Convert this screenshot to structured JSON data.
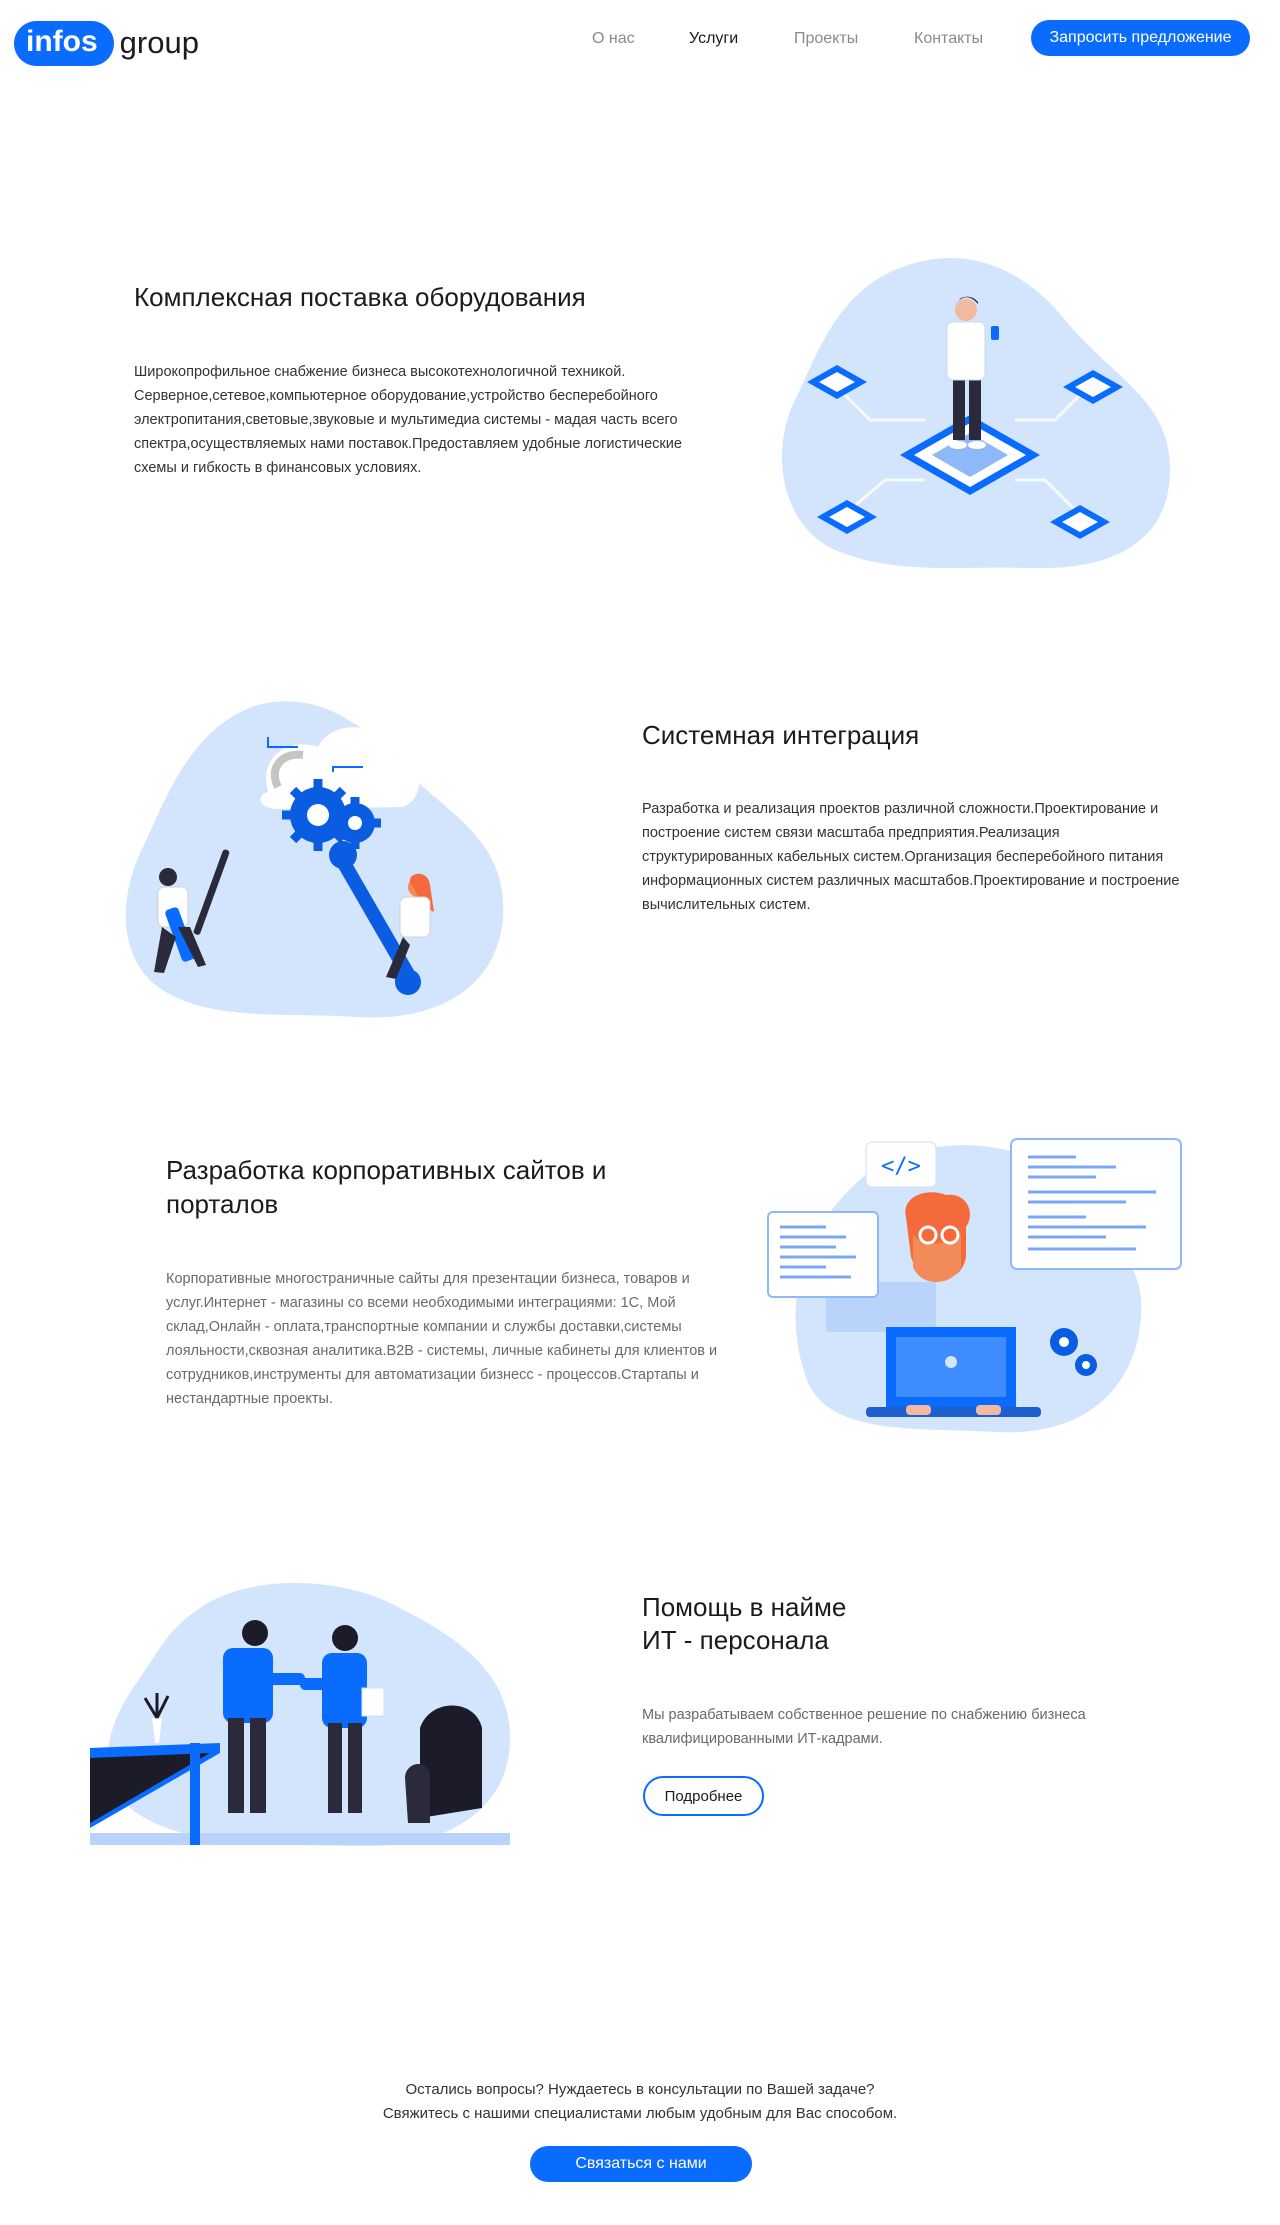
{
  "header": {
    "logo_pill": "infos",
    "logo_word": "group",
    "nav": {
      "about": "О нас",
      "services": "Услуги",
      "projects": "Проекты",
      "contacts": "Контакты"
    },
    "cta": "Запросить предложение"
  },
  "sections": [
    {
      "title": "Комплексная поставка оборудования",
      "text": "Широкопрофильное снабжение бизнеса высокотехнологичной техникой. Серверное,сетевое,компьютерное оборудование,устройство бесперебойного электропитания,световые,звуковые и мультимедиа системы - мадая часть всего спектра,осуществляемых нами поставок.Предоставляем удобные логистические схемы и гибкость в финансовых условиях.",
      "illustration": "server-chip-illustration"
    },
    {
      "title": "Системная интеграция",
      "text": "Разработка и реализация проектов различной сложности.Проектирование и построение систем связи масштаба предприятия.Реализация структурированных кабельных систем.Организация бесперебойного питания информационных систем различных масштабов.Проектирование и построение вычислительных систем.",
      "illustration": "gears-tools-illustration"
    },
    {
      "title": "Разработка корпоративных сайтов и порталов",
      "text": "Корпоративные многостраничные сайты для презентации бизнеса, товаров и услуг.Интернет - магазины со всеми необходимыми интеграциями: 1С, Мой склад,Онлайн - оплата,транспортные компании и службы доставки,системы лояльности,сквозная аналитика.B2B - системы, личные кабинеты для клиентов и сотрудников,инструменты для автоматизации бизнесс - процессов.Стартапы и нестандартные проекты.",
      "illustration": "developer-illustration",
      "code_tag": "</>"
    },
    {
      "title_line1": "Помощь в найме",
      "title_line2": "ИТ - персонала",
      "text": "Мы разрабатываем собственное решение по снабжению бизнеса квалифицированными ИТ-кадрами.",
      "button": "Подробнее",
      "illustration": "handshake-illustration"
    }
  ],
  "footer": {
    "line1": "Остались вопросы? Нуждаетесь в консультации по Вашей задаче?",
    "line2": "Свяжитесь с нашими специалистами любым удобным для Вас способом.",
    "button": "Связаться с нами"
  },
  "colors": {
    "accent": "#0a6cff",
    "blob": "#d3e4fd",
    "blob_dark": "#b9d3fb"
  }
}
